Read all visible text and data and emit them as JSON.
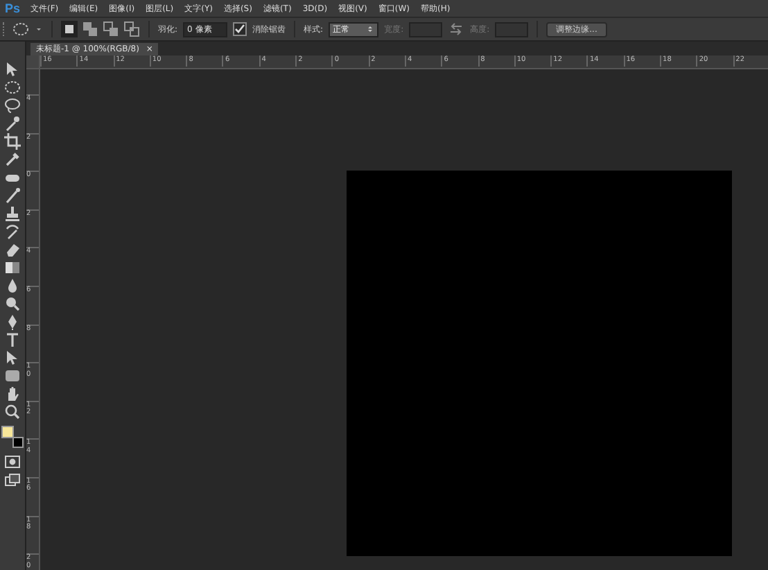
{
  "app": {
    "logo": "Ps"
  },
  "menu": [
    "文件(F)",
    "编辑(E)",
    "图像(I)",
    "图层(L)",
    "文字(Y)",
    "选择(S)",
    "滤镜(T)",
    "3D(D)",
    "视图(V)",
    "窗口(W)",
    "帮助(H)"
  ],
  "options_bar": {
    "feather": {
      "label": "羽化:",
      "value": "0 像素"
    },
    "anti_alias": {
      "label": "消除锯齿",
      "checked": true
    },
    "style": {
      "label": "样式:",
      "value": "正常"
    },
    "width": {
      "label": "宽度:",
      "disabled": true
    },
    "height": {
      "label": "高度:",
      "disabled": true
    },
    "refine_button": "调整边缘..."
  },
  "document_tab": {
    "title": "未标题-1 @ 100%(RGB/8)",
    "close": "×",
    "selected": true
  },
  "ruler_horizontal": [
    "16",
    "14",
    "12",
    "10",
    "8",
    "6",
    "4",
    "2",
    "0",
    "2",
    "4",
    "6",
    "8",
    "10",
    "12",
    "14",
    "16",
    "18",
    "20",
    "22"
  ],
  "ruler_vertical": [
    "4",
    "2",
    "0",
    "2",
    "4",
    "6",
    "8",
    "10",
    "12",
    "14",
    "16",
    "18",
    "20"
  ]
}
